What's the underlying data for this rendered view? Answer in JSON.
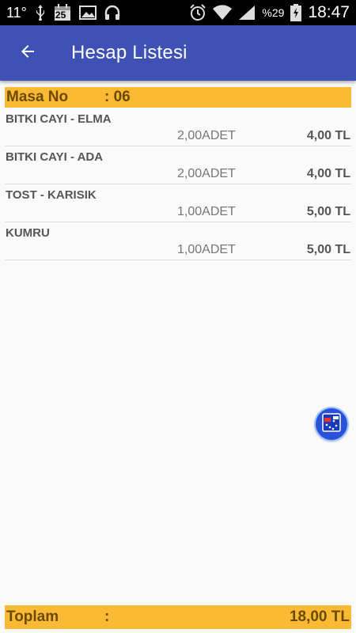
{
  "status_bar": {
    "temperature": "11°",
    "calendar_day": "25",
    "battery_percent": "%29",
    "time": "18:47"
  },
  "app_bar": {
    "title": "Hesap Listesi"
  },
  "header": {
    "label": "Masa No",
    "value": ": 06"
  },
  "items": [
    {
      "name": "BITKI CAYI - ELMA",
      "quantity": "2,00ADET",
      "price": "4,00 TL"
    },
    {
      "name": "BITKI CAYI - ADA",
      "quantity": "2,00ADET",
      "price": "4,00 TL"
    },
    {
      "name": "TOST - KARISIK",
      "quantity": "1,00ADET",
      "price": "5,00 TL"
    },
    {
      "name": "KUMRU",
      "quantity": "1,00ADET",
      "price": "5,00 TL"
    }
  ],
  "footer": {
    "label": "Toplam",
    "separator": ":",
    "total": "18,00 TL"
  },
  "colors": {
    "app_bar": "#3f51b5",
    "highlight": "#fbba34",
    "highlight_text": "#6b4a00"
  }
}
